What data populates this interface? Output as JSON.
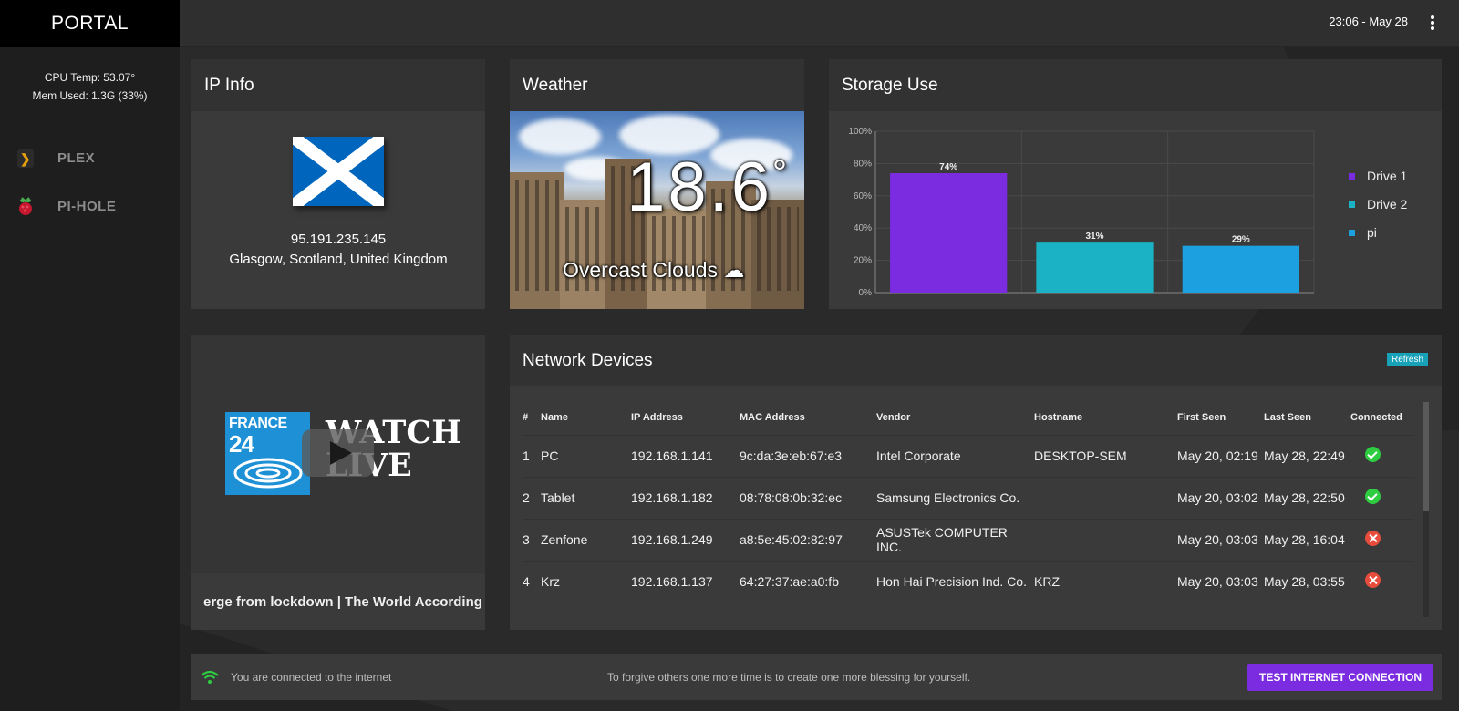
{
  "app": {
    "brand": "PORTAL"
  },
  "system": {
    "cpu_temp": "CPU Temp: 53.07°",
    "mem_used": "Mem Used: 1.3G (33%)"
  },
  "sidebar": {
    "items": [
      {
        "label": "PLEX",
        "icon": "plex-icon"
      },
      {
        "label": "PI-HOLE",
        "icon": "raspberry-icon"
      }
    ]
  },
  "topbar": {
    "clock": "23:06 - May 28",
    "menu_icon": "kebab-menu-icon"
  },
  "ip_info": {
    "title": "IP Info",
    "ip": "95.191.235.145",
    "location": "Glasgow, Scotland, United Kingdom",
    "flag": "scotland-flag",
    "colors": {
      "flag_blue": "#0065BD",
      "flag_white": "#ffffff"
    }
  },
  "weather": {
    "title": "Weather",
    "temperature": "18.6",
    "degree": "°",
    "condition": "Overcast Clouds ☁"
  },
  "storage": {
    "title": "Storage Use",
    "legend": [
      "Drive 1",
      "Drive 2",
      "pi"
    ],
    "colors": [
      "#7b2be0",
      "#1ab2c4",
      "#1ca0e0"
    ]
  },
  "chart_data": {
    "type": "bar",
    "categories": [
      "Drive 1",
      "Drive 2",
      "pi"
    ],
    "values": [
      74,
      31,
      29
    ],
    "value_labels": [
      "74%",
      "31%",
      "29%"
    ],
    "yticks": [
      "0%",
      "20%",
      "40%",
      "60%",
      "80%",
      "100%"
    ],
    "ylim": [
      0,
      100
    ],
    "legend": "right",
    "grid": true
  },
  "video": {
    "logo_line1": "FRANCE",
    "logo_line2": "24",
    "watch_line1": "WATCH",
    "watch_line2": "LIVE",
    "ticker": "erge from lockdown | The World According"
  },
  "network": {
    "title": "Network Devices",
    "refresh_label": "Refresh",
    "columns": [
      "#",
      "Name",
      "IP Address",
      "MAC Address",
      "Vendor",
      "Hostname",
      "First Seen",
      "Last Seen",
      "Connected"
    ],
    "rows": [
      {
        "num": "1",
        "name": "PC",
        "ip": "192.168.1.141",
        "mac": "9c:da:3e:eb:67:e3",
        "vendor": "Intel Corporate",
        "hostname": "DESKTOP-SEM",
        "first_seen": "May 20, 02:19",
        "last_seen": "May 28, 22:49",
        "connected": true
      },
      {
        "num": "2",
        "name": "Tablet",
        "ip": "192.168.1.182",
        "mac": "08:78:08:0b:32:ec",
        "vendor": "Samsung Electronics Co.",
        "hostname": "",
        "first_seen": "May 20, 03:02",
        "last_seen": "May 28, 22:50",
        "connected": true
      },
      {
        "num": "3",
        "name": "Zenfone",
        "ip": "192.168.1.249",
        "mac": "a8:5e:45:02:82:97",
        "vendor": "ASUSTek COMPUTER INC.",
        "hostname": "",
        "first_seen": "May 20, 03:03",
        "last_seen": "May 28, 16:04",
        "connected": false
      },
      {
        "num": "4",
        "name": "Krz",
        "ip": "192.168.1.137",
        "mac": "64:27:37:ae:a0:fb",
        "vendor": "Hon Hai Precision Ind. Co.",
        "hostname": "KRZ",
        "first_seen": "May 20, 03:03",
        "last_seen": "May 28, 03:55",
        "connected": false
      }
    ]
  },
  "footer": {
    "status": "You are connected to the internet",
    "quote": "To forgive others one more time is to create one more blessing for yourself.",
    "button": "TEST INTERNET CONNECTION",
    "colors": {
      "accent": "#7b2be0",
      "wifi": "#2ecc40"
    }
  }
}
